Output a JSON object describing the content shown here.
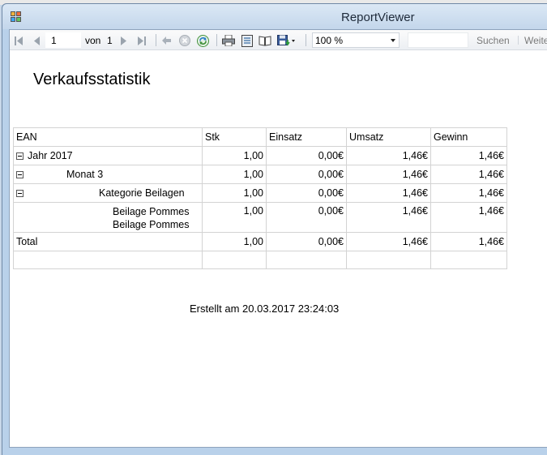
{
  "window": {
    "title": "ReportViewer"
  },
  "toolbar": {
    "page_value": "1",
    "page_of_label": "von",
    "page_total": "1",
    "zoom_value": "100 %",
    "search_placeholder": "",
    "find_label": "Suchen",
    "next_label": "Weite"
  },
  "report": {
    "title": "Verkaufsstatistik",
    "columns": [
      "EAN",
      "Stk",
      "Einsatz",
      "Umsatz",
      "Gewinn"
    ],
    "rows": [
      {
        "label": "Jahr 2017",
        "stk": "1,00",
        "einsatz": "0,00€",
        "umsatz": "1,46€",
        "gewinn": "1,46€"
      },
      {
        "label": "Monat 3",
        "stk": "1,00",
        "einsatz": "0,00€",
        "umsatz": "1,46€",
        "gewinn": "1,46€"
      },
      {
        "label": "Kategorie Beilagen",
        "stk": "1,00",
        "einsatz": "0,00€",
        "umsatz": "1,46€",
        "gewinn": "1,46€"
      },
      {
        "label_line1": "Beilage Pommes",
        "label_line2": "Beilage Pommes",
        "stk": "1,00",
        "einsatz": "0,00€",
        "umsatz": "1,46€",
        "gewinn": "1,46€"
      }
    ],
    "total": {
      "label": "Total",
      "stk": "1,00",
      "einsatz": "0,00€",
      "umsatz": "1,46€",
      "gewinn": "1,46€"
    },
    "footer": "Erstellt am 20.03.2017 23:24:03"
  }
}
